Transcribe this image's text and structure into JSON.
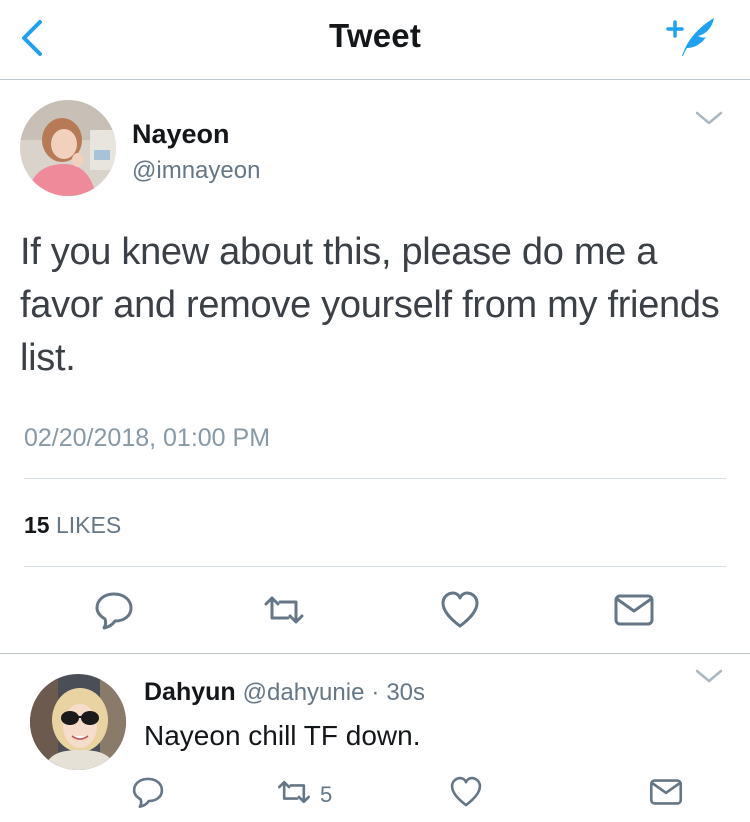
{
  "navbar": {
    "title": "Tweet",
    "back_icon": "chevron-left-icon",
    "compose_icon": "compose-feather-icon"
  },
  "colors": {
    "accent": "#1da1f2",
    "icon_gray": "#657786",
    "text_dark": "#14171a",
    "text_light": "#8899a6",
    "divider": "#d6dde2"
  },
  "tweet": {
    "author_name": "Nayeon",
    "author_handle": "@imnayeon",
    "text": "If you knew about this, please do me a favor and remove yourself from my friends list.",
    "timestamp": "02/20/2018, 01:00 PM",
    "likes_count": "15",
    "likes_label": "LIKES",
    "actions": [
      "reply-icon",
      "retweet-icon",
      "like-heart-icon",
      "direct-message-icon"
    ]
  },
  "reply": {
    "author_name": "Dahyun",
    "author_handle": "@dahyunie",
    "separator": "·",
    "time_ago": "30s",
    "text": "Nayeon chill TF down.",
    "retweet_count": "5",
    "actions": [
      "reply-icon",
      "retweet-icon",
      "like-heart-icon",
      "direct-message-icon"
    ]
  }
}
